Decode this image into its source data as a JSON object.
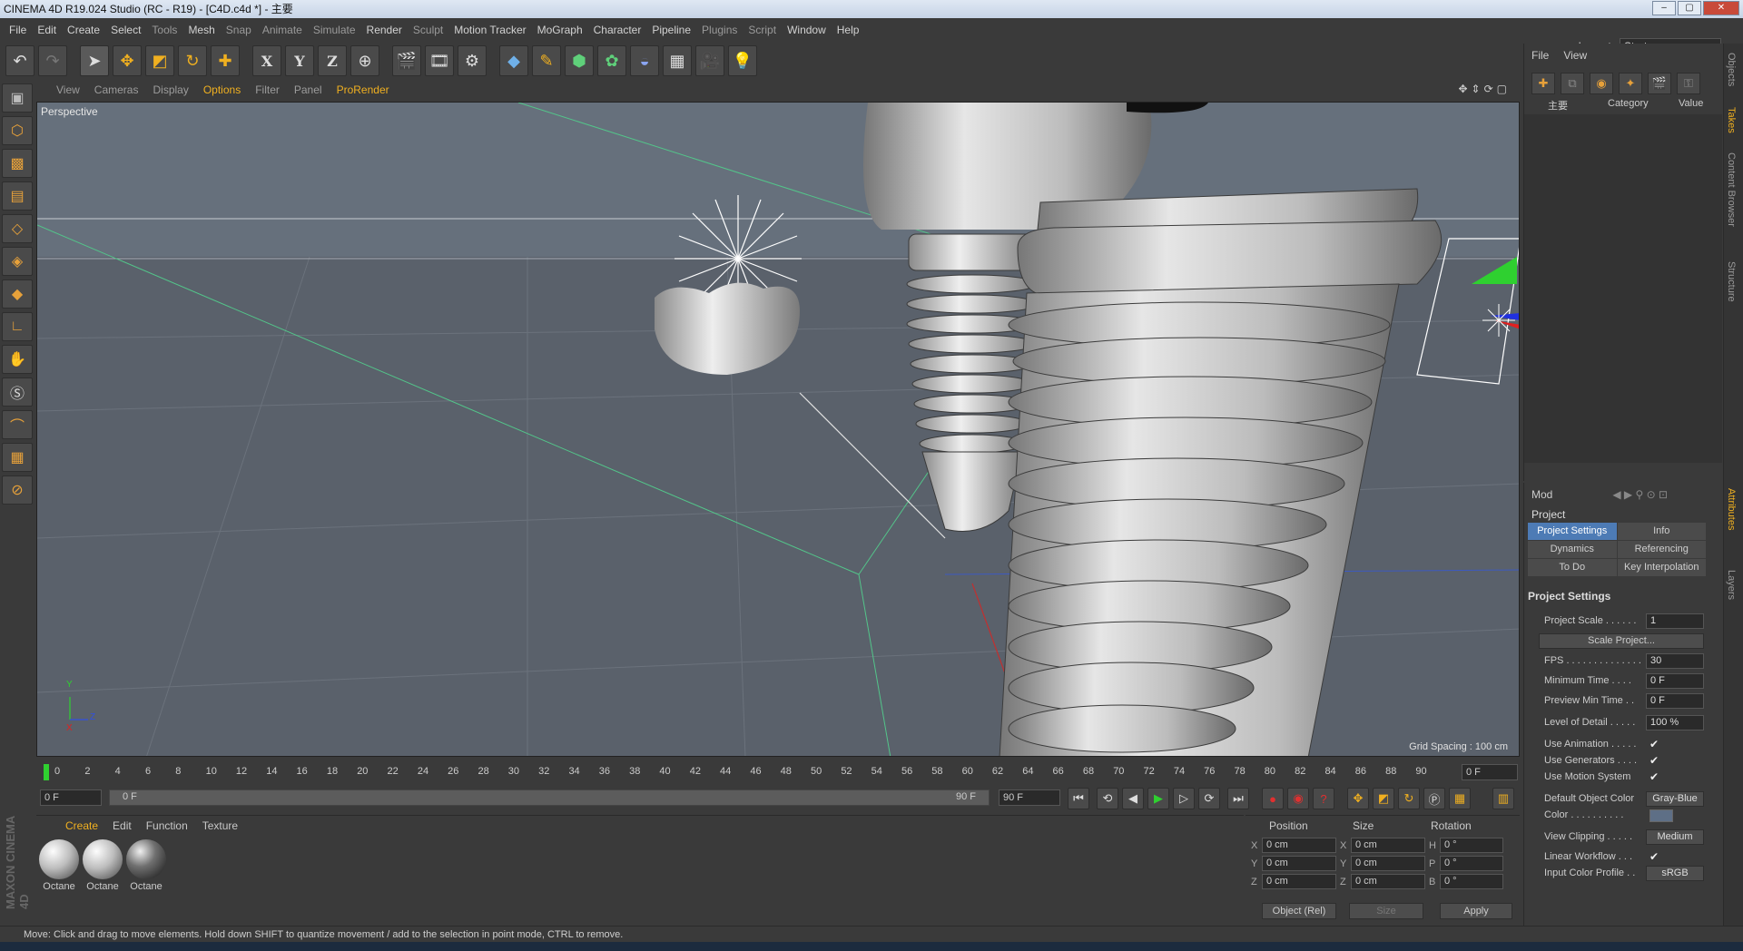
{
  "window": {
    "title": "CINEMA 4D R19.024 Studio (RC - R19) - [C4D.c4d *] - 主要",
    "min": "–",
    "max": "▢",
    "close": "✕"
  },
  "menu": [
    "File",
    "Edit",
    "Create",
    "Select",
    "Tools",
    "Mesh",
    "Snap",
    "Animate",
    "Simulate",
    "Render",
    "Sculpt",
    "Motion Tracker",
    "MoGraph",
    "Character",
    "Pipeline",
    "Plugins",
    "Script",
    "Window",
    "Help"
  ],
  "layout": {
    "label": "Layout:",
    "value": "Startup"
  },
  "viewport_menu": [
    "View",
    "Cameras",
    "Display",
    "Options",
    "Filter",
    "Panel",
    "ProRender"
  ],
  "viewport": {
    "label": "Perspective",
    "grid_spacing": "Grid Spacing : 100 cm",
    "axis_y": "Y",
    "axis_z": "Z",
    "axis_x": "X"
  },
  "timeline": {
    "ticks": [
      "0",
      "2",
      "4",
      "6",
      "8",
      "10",
      "12",
      "14",
      "16",
      "18",
      "20",
      "22",
      "24",
      "26",
      "28",
      "30",
      "32",
      "34",
      "36",
      "38",
      "40",
      "42",
      "44",
      "46",
      "48",
      "50",
      "52",
      "54",
      "56",
      "58",
      "60",
      "62",
      "64",
      "66",
      "68",
      "70",
      "72",
      "74",
      "76",
      "78",
      "80",
      "82",
      "84",
      "86",
      "88",
      "90"
    ],
    "current": "0 F"
  },
  "playback": {
    "start": "0 F",
    "range_start": "0 F",
    "range_end": "90 F",
    "end": "90 F"
  },
  "materials": {
    "menu": [
      "Create",
      "Edit",
      "Function",
      "Texture"
    ],
    "items": [
      "Octane",
      "Octane",
      "Octane"
    ]
  },
  "coords": {
    "headers": [
      "Position",
      "Size",
      "Rotation"
    ],
    "rows": [
      {
        "a": "X",
        "pos": "0 cm",
        "b": "X",
        "size": "0 cm",
        "c": "H",
        "rot": "0 °"
      },
      {
        "a": "Y",
        "pos": "0 cm",
        "b": "Y",
        "size": "0 cm",
        "c": "P",
        "rot": "0 °"
      },
      {
        "a": "Z",
        "pos": "0 cm",
        "b": "Z",
        "size": "0 cm",
        "c": "B",
        "rot": "0 °"
      }
    ],
    "mode": "Object (Rel)",
    "size_mode": "Size",
    "apply": "Apply"
  },
  "status": "Move: Click and drag to move elements. Hold down SHIFT to quantize movement / add to the selection in point mode, CTRL to remove.",
  "objects": {
    "menu": [
      "File",
      "View"
    ],
    "col_name": "主要",
    "col_category": "Category",
    "col_value": "Value"
  },
  "attributes": {
    "menu": "Mod",
    "title": "Project",
    "tabs": [
      "Project Settings",
      "Info",
      "Dynamics",
      "Referencing",
      "To Do",
      "Key Interpolation"
    ],
    "section": "Project Settings",
    "rows": [
      {
        "k": "Project Scale . . . . . .",
        "v": "1"
      },
      {
        "btn": "Scale Project..."
      },
      {
        "k": "FPS . . . . . . . . . . . . . .",
        "v": "30"
      },
      {
        "k": "Minimum Time . . . .",
        "v": "0 F"
      },
      {
        "k": "Preview Min Time . .",
        "v": "0 F"
      },
      {
        "k": "Level of Detail . . . . .",
        "v": "100 %"
      },
      {
        "k": "Use Animation . . . . .",
        "chk": "✔"
      },
      {
        "k": "Use Generators . . . .",
        "chk": "✔"
      },
      {
        "k": "Use Motion System",
        "chk": "✔"
      },
      {
        "k": "Default Object Color",
        "vb": "Gray-Blue"
      },
      {
        "k": "Color . . . . . . . . . .",
        "sw": "#5e6f86"
      },
      {
        "k": "View Clipping . . . . .",
        "vb": "Medium"
      },
      {
        "k": "Linear Workflow . . .",
        "chk": "✔"
      },
      {
        "k": "Input Color Profile . .",
        "vb": "sRGB"
      }
    ]
  },
  "side_tabs": [
    "Objects",
    "Takes",
    "Content Browser",
    "Structure",
    "Attributes",
    "Layers"
  ]
}
